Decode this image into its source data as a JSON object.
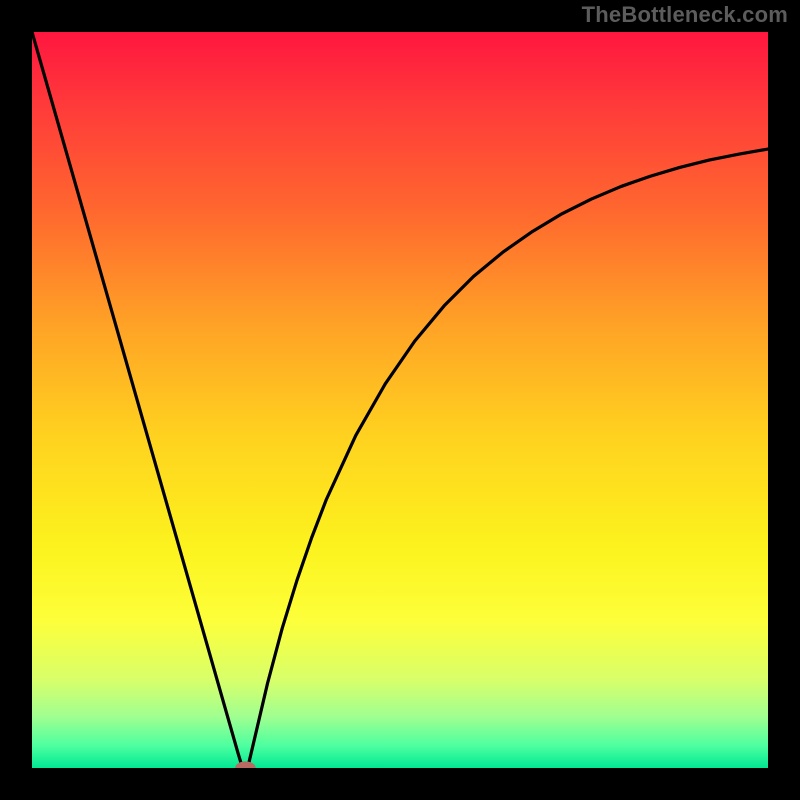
{
  "watermark": "TheBottleneck.com",
  "gradient": {
    "stops": [
      {
        "offset": 0.0,
        "color": "#ff163f"
      },
      {
        "offset": 0.1,
        "color": "#ff3a3a"
      },
      {
        "offset": 0.25,
        "color": "#ff6a2e"
      },
      {
        "offset": 0.4,
        "color": "#ffa326"
      },
      {
        "offset": 0.55,
        "color": "#ffd21f"
      },
      {
        "offset": 0.7,
        "color": "#fcf31e"
      },
      {
        "offset": 0.8,
        "color": "#fdff3a"
      },
      {
        "offset": 0.88,
        "color": "#d8ff6a"
      },
      {
        "offset": 0.93,
        "color": "#a0ff90"
      },
      {
        "offset": 0.97,
        "color": "#4dffa0"
      },
      {
        "offset": 1.0,
        "color": "#00e892"
      }
    ]
  },
  "chart_data": {
    "type": "line",
    "title": "",
    "xlabel": "",
    "ylabel": "",
    "xlim": [
      0,
      100
    ],
    "ylim": [
      0,
      100
    ],
    "x": [
      0,
      2,
      4,
      6,
      8,
      10,
      12,
      14,
      16,
      18,
      20,
      22,
      24,
      26,
      28,
      28.6,
      29.3,
      32,
      34,
      36,
      38,
      40,
      44,
      48,
      52,
      56,
      60,
      64,
      68,
      72,
      76,
      80,
      84,
      88,
      92,
      96,
      100
    ],
    "y": [
      100,
      93.0,
      86.0,
      79.0,
      72.0,
      65.0,
      58.0,
      51.0,
      44.0,
      37.0,
      30.0,
      23.0,
      16.0,
      9.0,
      2.0,
      0.0,
      0.0,
      11.5,
      19.0,
      25.5,
      31.3,
      36.5,
      45.2,
      52.2,
      58.0,
      62.8,
      66.8,
      70.1,
      72.9,
      75.3,
      77.3,
      79.0,
      80.4,
      81.6,
      82.6,
      83.4,
      84.1
    ],
    "marker": {
      "x": 29.0,
      "y": 0.0,
      "rx_pct": 1.4,
      "ry_pct": 0.9
    }
  }
}
